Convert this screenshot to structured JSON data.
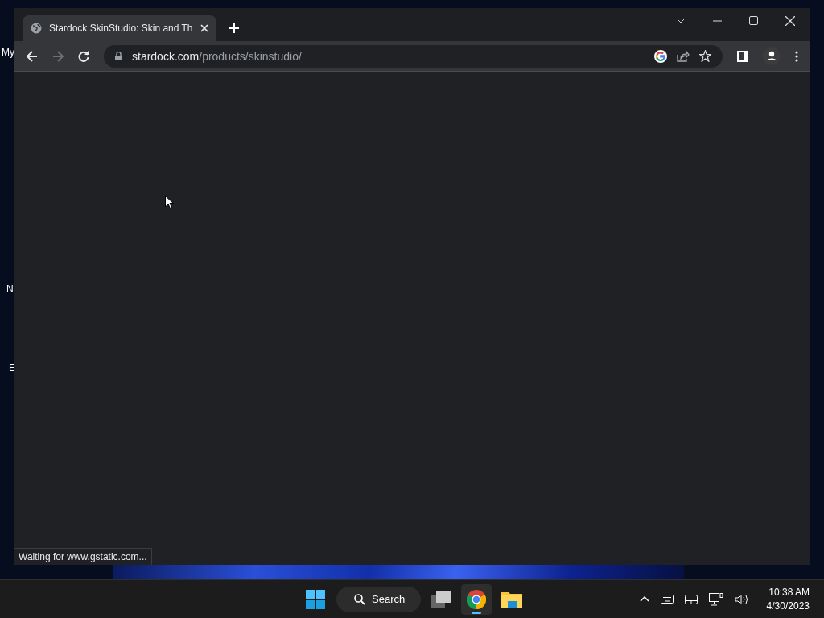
{
  "desktop_icons": [
    {
      "label": "My"
    },
    {
      "label": "N"
    },
    {
      "label": "E"
    }
  ],
  "browser": {
    "tab": {
      "title": "Stardock SkinStudio: Skin and Th",
      "selected": true
    },
    "address": {
      "host": "stardock.com",
      "path": "/products/skinstudio/"
    },
    "status": "Waiting for www.gstatic.com..."
  },
  "taskbar": {
    "search": "Search",
    "apps": [
      {
        "kind": "taskview",
        "selected": false
      },
      {
        "kind": "chrome",
        "selected": true
      },
      {
        "kind": "explorer",
        "selected": false
      }
    ],
    "time": "10:38 AM",
    "date": "4/30/2023"
  }
}
